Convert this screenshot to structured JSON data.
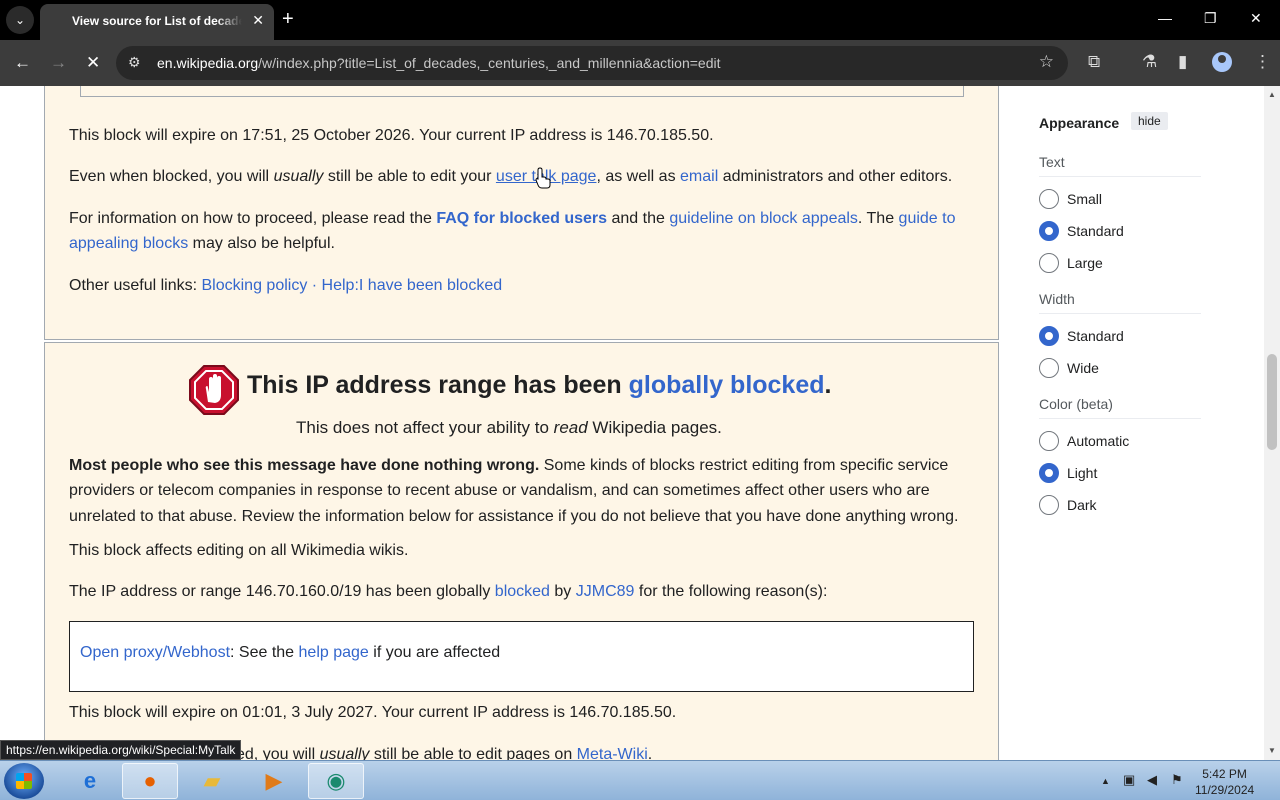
{
  "browser": {
    "tab_title": "View source for List of decades, centuries, and millennia",
    "url_host": "en.wikipedia.org",
    "url_path": "/w/index.php?title=List_of_decades,_centuries,_and_millennia&action=edit",
    "status_url": "https://en.wikipedia.org/wiki/Special:MyTalk"
  },
  "block1": {
    "expire": "This block will expire on 17:51, 25 October 2026. Your current IP address is 146.70.185.50.",
    "p2_a": "Even when blocked, you will ",
    "p2_i": "usually",
    "p2_b": " still be able to edit your ",
    "p2_link1": "user talk page",
    "p2_c": ", as well as ",
    "p2_link2": "email",
    "p2_d": " administrators and other editors.",
    "p3_a": "For information on how to proceed, please read the ",
    "p3_link1": "FAQ for blocked users",
    "p3_b": " and the ",
    "p3_link2": "guideline on block appeals",
    "p3_c": ". The ",
    "p3_link3a": "guide to",
    "p3_link3b": "appealing blocks",
    "p3_d": " may also be helpful.",
    "p4_a": "Other useful links: ",
    "p4_link1": "Blocking policy",
    "p4_sep": " · ",
    "p4_link2": "Help:I have been blocked"
  },
  "block2": {
    "heading_a": "This IP address range has been ",
    "heading_link": "globally blocked",
    "heading_b": ".",
    "sub_a": "This does not affect your ability to ",
    "sub_i": "read",
    "sub_b": " Wikipedia pages.",
    "p1_bold": "Most people who see this message have done nothing wrong.",
    "p1_l1": " Some kinds of blocks restrict editing from specific service",
    "p1_l2": "providers or telecom companies in response to recent abuse or vandalism, and can sometimes affect other users who are",
    "p1_l3": "unrelated to that abuse. Review the information below for assistance if you do not believe that you have done anything wrong.",
    "p2": "This block affects editing on all Wikimedia wikis.",
    "p3_a": "The IP address or range 146.70.160.0/19 has been globally ",
    "p3_link1": "blocked",
    "p3_b": " by ",
    "p3_link2": "JJMC89",
    "p3_c": " for the following reason(s):",
    "reason_link1": "Open proxy/Webhost",
    "reason_a": ": See the ",
    "reason_link2": "help page",
    "reason_b": " if you are affected",
    "expire": "This block will expire on 01:01, 3 July 2027. Your current IP address is 146.70.185.50.",
    "last_a": "ked, you will ",
    "last_i": "usually",
    "last_b": " still be able to edit pages on ",
    "last_link": "Meta-Wiki",
    "last_c": "."
  },
  "appearance": {
    "title": "Appearance",
    "hide": "hide",
    "text_label": "Text",
    "text_options": [
      "Small",
      "Standard",
      "Large"
    ],
    "text_selected": "Standard",
    "width_label": "Width",
    "width_options": [
      "Standard",
      "Wide"
    ],
    "width_selected": "Standard",
    "color_label": "Color (beta)",
    "color_options": [
      "Automatic",
      "Light",
      "Dark"
    ],
    "color_selected": "Light"
  },
  "taskbar": {
    "time": "5:42 PM",
    "date": "11/29/2024"
  },
  "colors": {
    "link": "#3366cc",
    "notice_bg": "#fef6e7",
    "radio_selected": "#3366cc"
  }
}
